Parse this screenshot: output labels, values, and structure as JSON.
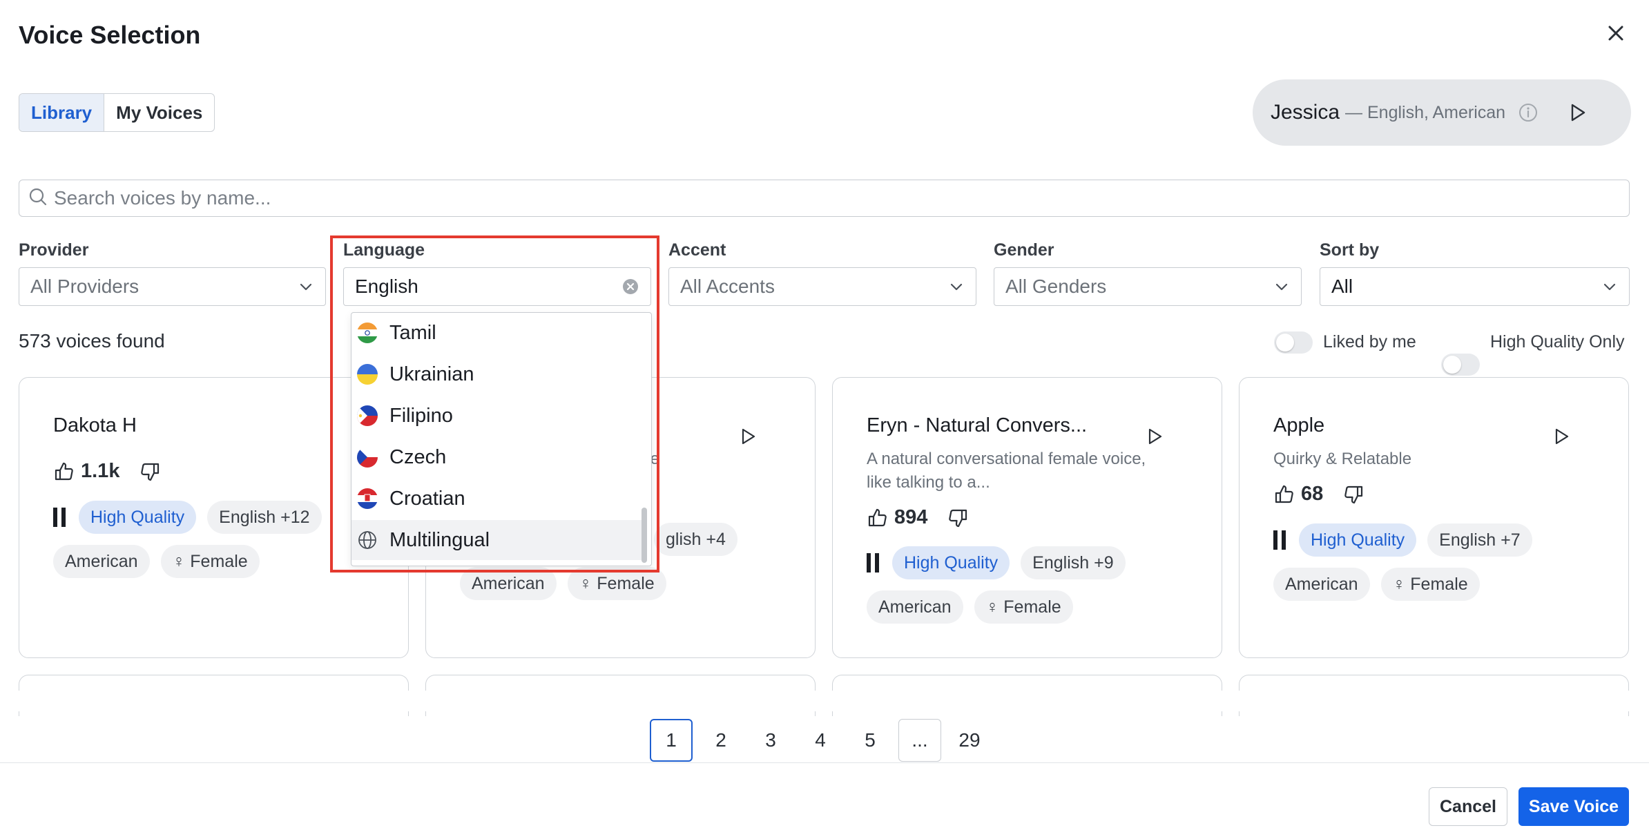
{
  "dialog": {
    "title": "Voice Selection"
  },
  "tabs": [
    {
      "label": "Library",
      "active": true
    },
    {
      "label": "My Voices",
      "active": false
    }
  ],
  "current_voice": {
    "name": "Jessica",
    "meta": "— English, American"
  },
  "search": {
    "placeholder": "Search voices by name..."
  },
  "filters": {
    "provider": {
      "label": "Provider",
      "value": "All Providers"
    },
    "language": {
      "label": "Language",
      "value": "English"
    },
    "accent": {
      "label": "Accent",
      "value": "All Accents"
    },
    "gender": {
      "label": "Gender",
      "value": "All Genders"
    },
    "sort": {
      "label": "Sort by",
      "value": "All"
    }
  },
  "results": {
    "count_text": "573 voices found"
  },
  "toggles": {
    "liked": {
      "label": "Liked by me",
      "on": false
    },
    "hq": {
      "label": "High Quality Only",
      "on": false
    }
  },
  "language_dropdown": {
    "options": [
      "Tamil",
      "Ukrainian",
      "Filipino",
      "Czech",
      "Croatian",
      "Multilingual"
    ],
    "highlighted": "Multilingual"
  },
  "cards": [
    {
      "name": "Dakota H",
      "description": "",
      "likes": "1.1k",
      "chips": [
        "High Quality",
        "English +12",
        "American",
        "♀ Female"
      ]
    },
    {
      "name": "",
      "description": "te",
      "likes": "",
      "chips": [
        "glish +4",
        "American",
        "♀ Female"
      ]
    },
    {
      "name": "Eryn - Natural Convers...",
      "description": "A natural conversational female voice, like talking to a...",
      "likes": "894",
      "chips": [
        "High Quality",
        "English +9",
        "American",
        "♀ Female"
      ]
    },
    {
      "name": "Apple",
      "description": "Quirky & Relatable",
      "likes": "68",
      "chips": [
        "High Quality",
        "English +7",
        "American",
        "♀ Female"
      ]
    }
  ],
  "pagination": {
    "pages": [
      "1",
      "2",
      "3",
      "4",
      "5",
      "...",
      "29"
    ],
    "current": "1"
  },
  "footer": {
    "cancel_label": "Cancel",
    "save_label": "Save Voice"
  },
  "colors": {
    "accent": "#1463e8",
    "highlight_box": "#e43a2f",
    "hq_chip_bg": "#dde7f8"
  }
}
